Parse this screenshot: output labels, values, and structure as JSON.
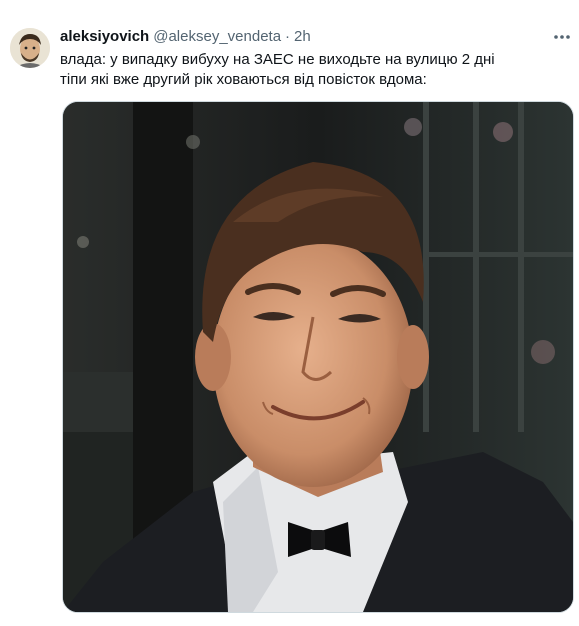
{
  "tweet": {
    "display_name": "aleksiyovich",
    "handle": "@aleksey_vendeta",
    "separator": "·",
    "time": "2h",
    "more_icon": "more-horizontal-icon",
    "text_lines": [
      "влада: у випадку вибуху на ЗАЕС не виходьте на вулицю 2 дні",
      "тіпи які вже другий рік ховаються від повісток вдома:"
    ],
    "media": {
      "kind": "photo",
      "subject": "smiling man in tuxedo with bow tie"
    }
  },
  "colors": {
    "text_primary": "#0f1419",
    "text_secondary": "#536471",
    "media_border": "#cfd9de"
  }
}
